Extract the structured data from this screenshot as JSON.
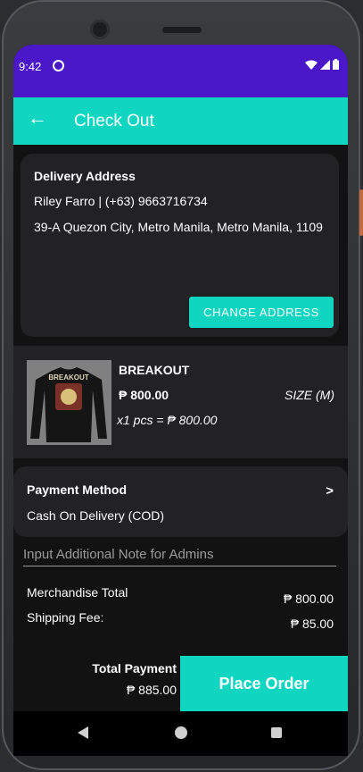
{
  "status_bar": {
    "time": "9:42"
  },
  "app_bar": {
    "title": "Check Out"
  },
  "address": {
    "label": "Delivery Address",
    "name_phone": "Riley Farro | (+63) 9663716734",
    "line": "39-A Quezon City, Metro Manila, Metro Manila, 1109",
    "change_button": "CHANGE ADDRESS"
  },
  "product": {
    "name": "BREAKOUT",
    "price": "₱ 800.00",
    "size": "SIZE (M)",
    "quantity_total": "x1 pcs  = ₱ 800.00",
    "image_print_text": "BREAKOUT"
  },
  "payment": {
    "label": "Payment Method",
    "value": "Cash On Delivery (COD)",
    "arrow": ">"
  },
  "note": {
    "placeholder": "Input Additional Note for Admins",
    "value": ""
  },
  "summary": {
    "merch_label": "Merchandise Total",
    "merch_value": "₱ 800.00",
    "ship_label": "Shipping Fee:",
    "ship_value": "₱ 85.00"
  },
  "footer": {
    "total_label": "Total Payment",
    "total_value": "₱ 885.00",
    "place_order": "Place Order"
  },
  "colors": {
    "accent": "#10d5c1",
    "status_bar": "#4a17c9",
    "background": "#121212",
    "card": "#222224"
  },
  "icons": [
    "back-arrow-icon",
    "wifi-icon",
    "signal-icon",
    "battery-icon",
    "chevron-right-icon",
    "nav-back-icon",
    "nav-home-icon",
    "nav-recent-icon"
  ]
}
